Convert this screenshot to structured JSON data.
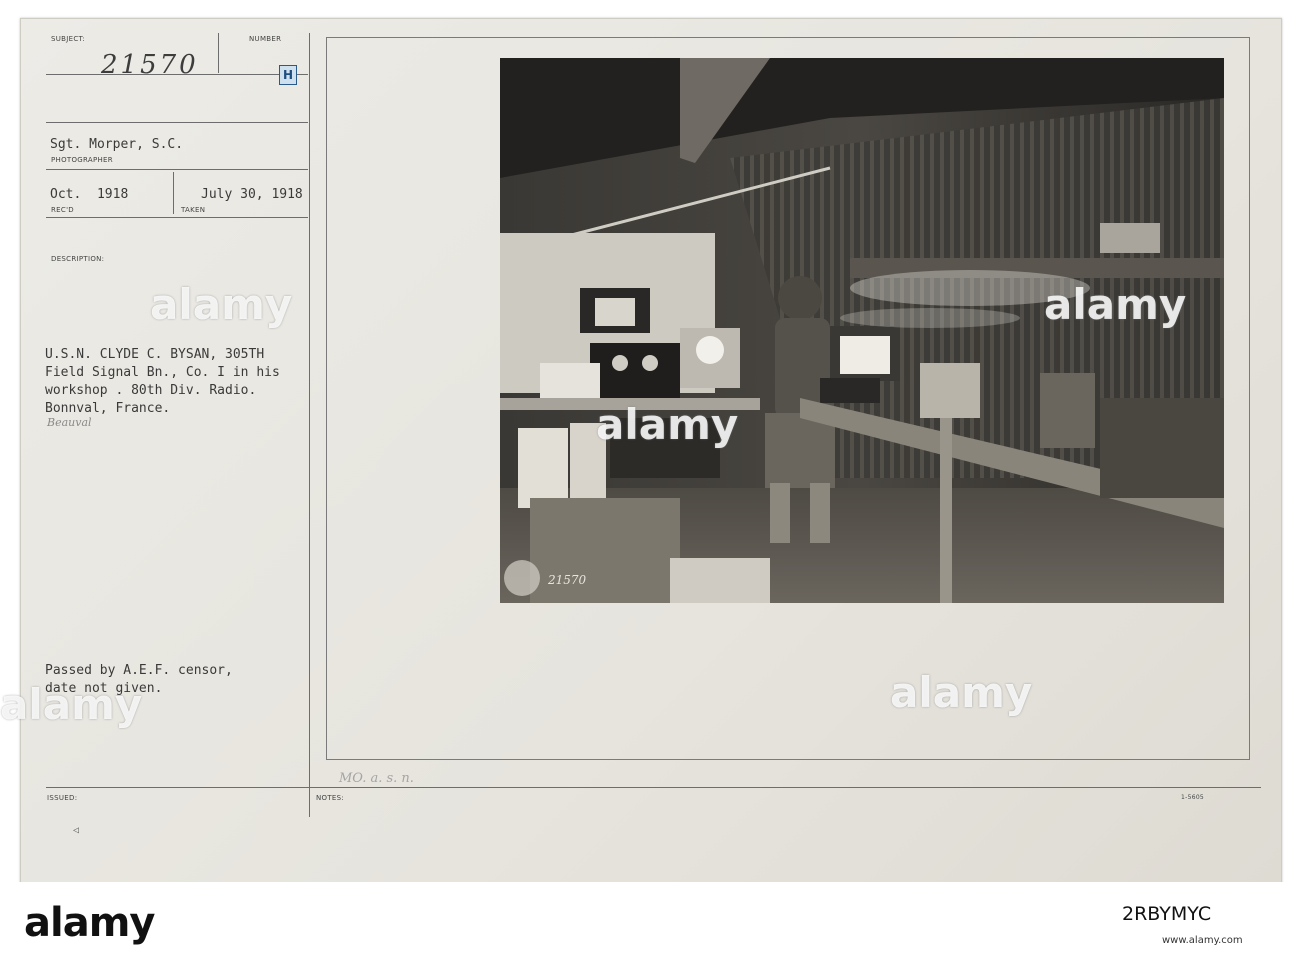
{
  "card": {
    "subject_label": "SUBJECT:",
    "subject_value": "21570",
    "number_label": "NUMBER",
    "number_badge": "H",
    "photographer_value": "Sgt. Morper, S.C.",
    "photographer_label": "PHOTOGRAPHER",
    "recd_value": "Oct.  1918",
    "recd_label": "REC'D",
    "taken_value": "July 30, 1918",
    "taken_label": "TAKEN",
    "description_label": "DESCRIPTION:",
    "description_lines": [
      "U.S.N. CLYDE C. BYSAN, 305TH",
      "Field Signal Bn., Co. I in his",
      "workshop . 80th Div. Radio.",
      "Bonnval, France."
    ],
    "description_handwritten": "Beauval",
    "censor_lines": [
      "Passed by A.E.F. censor,",
      "date not given."
    ],
    "issued_label": "ISSUED:",
    "notes_label": "NOTES:",
    "notes_handwritten": "MO. a. s. n.",
    "form_number": "1-5605",
    "photo_stamp_number": "21570"
  },
  "watermark": "alamy",
  "footer": {
    "logo": "alamy",
    "image_id": "2RBYMYC",
    "url": "www.alamy.com"
  }
}
